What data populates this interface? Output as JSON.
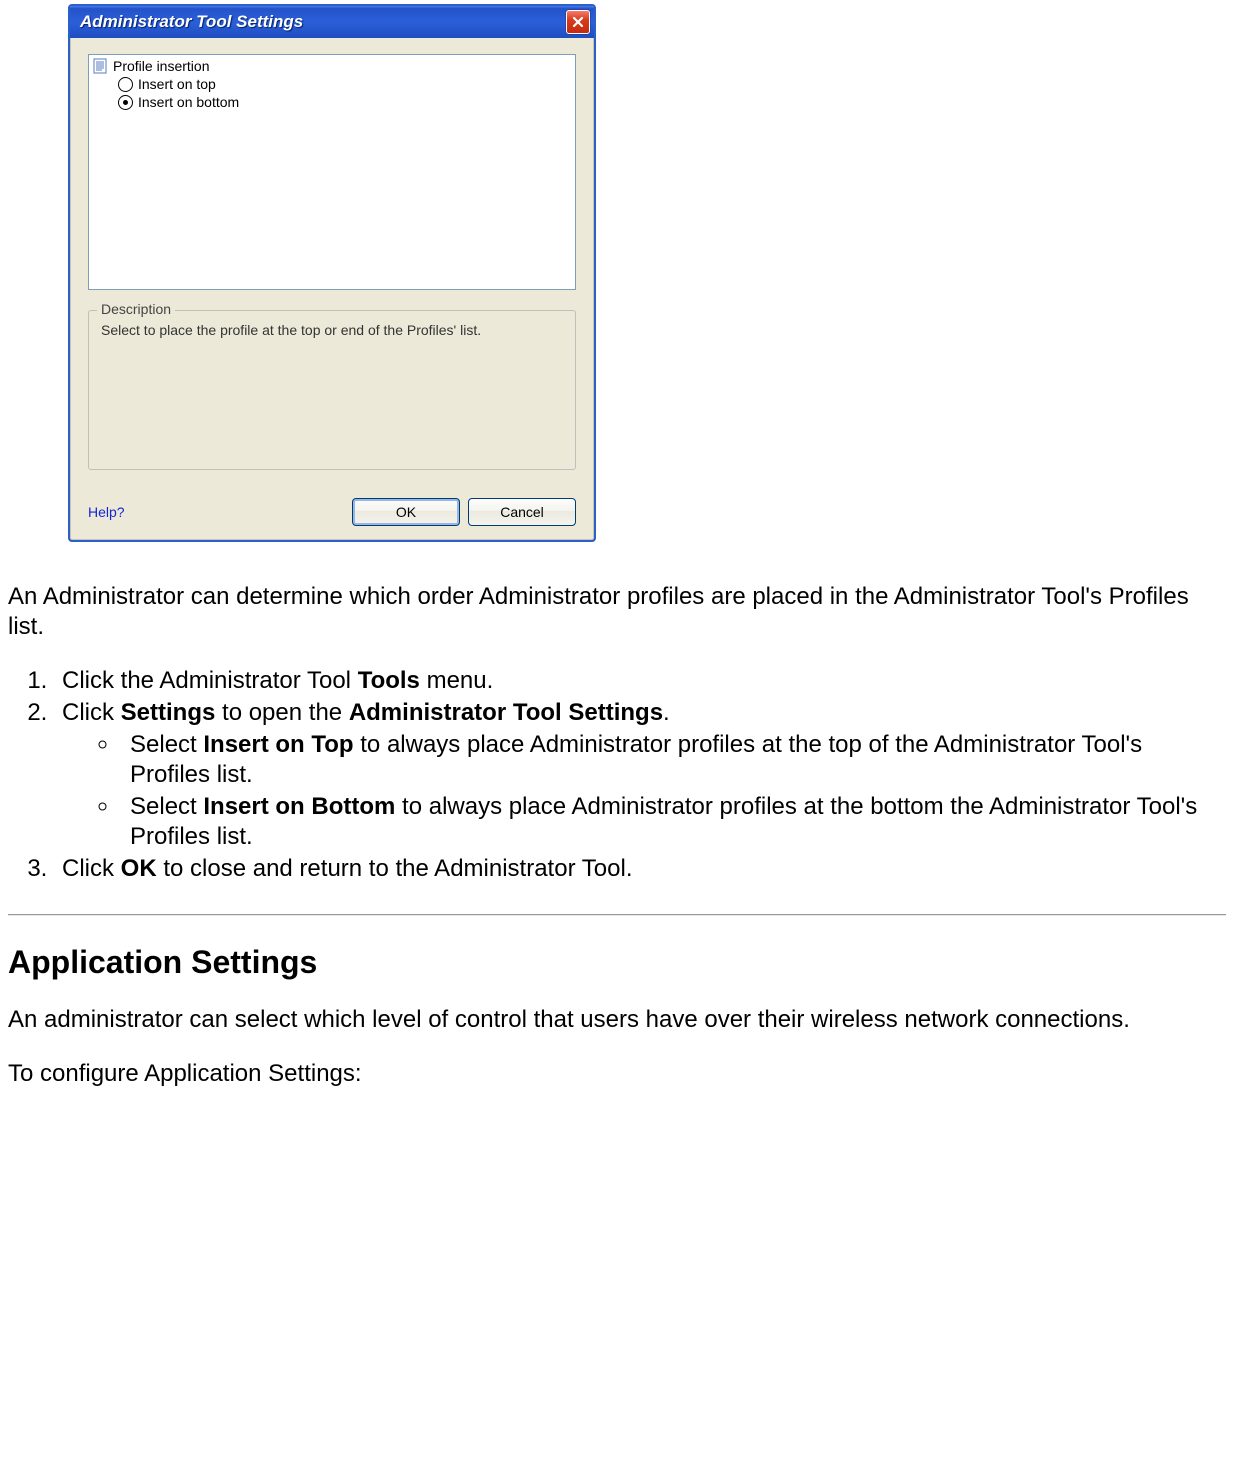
{
  "dialog": {
    "title": "Administrator Tool Settings",
    "tree": {
      "root_label": "Profile insertion",
      "option_top": "Insert on top",
      "option_bottom": "Insert on bottom",
      "selected": "bottom"
    },
    "description": {
      "legend": "Description",
      "text": "Select to place the profile at the top or end of the Profiles' list."
    },
    "help_label": "Help?",
    "ok_label": "OK",
    "cancel_label": "Cancel"
  },
  "doc": {
    "intro": "An Administrator can determine which order Administrator profiles are placed in the Administrator Tool's Profiles list.",
    "step1_a": "Click the Administrator Tool ",
    "step1_b": "Tools",
    "step1_c": " menu.",
    "step2_a": "Click ",
    "step2_b": "Settings",
    "step2_c": " to open the ",
    "step2_d": "Administrator Tool Settings",
    "step2_e": ".",
    "sub1_a": "Select ",
    "sub1_b": "Insert on Top",
    "sub1_c": " to always place Administrator profiles at the top of the Administrator Tool's Profiles list.",
    "sub2_a": "Select ",
    "sub2_b": "Insert on Bottom",
    "sub2_c": " to always place Administrator profiles at the bottom the Administrator Tool's Profiles list.",
    "step3_a": "Click ",
    "step3_b": "OK",
    "step3_c": " to close and return to the Administrator Tool.",
    "section_heading": "Application Settings",
    "section_para": "An administrator can select which level of control that users have over their wireless network connections.",
    "section_lead": "To configure Application Settings:"
  }
}
